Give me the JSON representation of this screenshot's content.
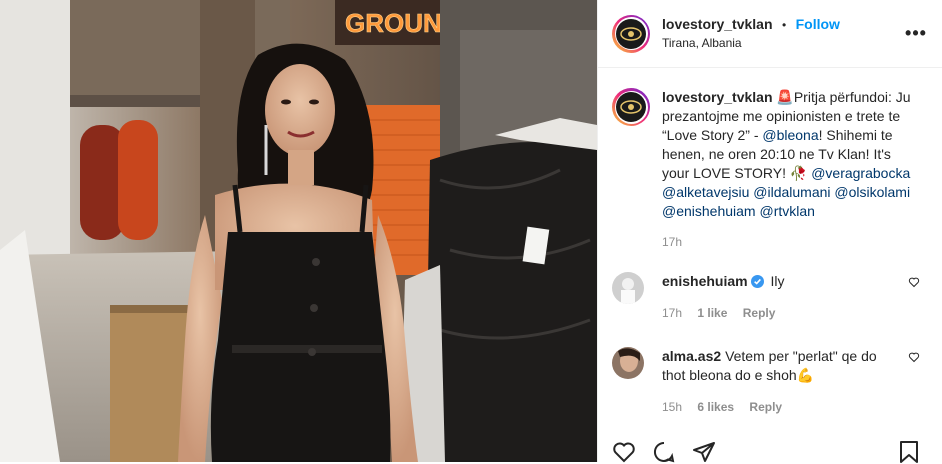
{
  "post": {
    "username": "lovestory_tvklan",
    "follow_label": "Follow",
    "location": "Tirana, Albania",
    "more_label": "•••",
    "photo_sign_text": "GROUND"
  },
  "caption": {
    "username": "lovestory_tvklan",
    "emoji_siren": "🚨",
    "text_1": "Pritja përfundoi: Ju prezantojme me opinionisten e trete te “Love Story 2” - ",
    "mention_1": "@bleona",
    "text_2": "! Shihemi te henen, ne oren 20:10 ne Tv Klan! It's your LOVE STORY! ",
    "emoji_rose": "🥀",
    "mentions": [
      "@veragrabocka",
      "@alketavejsiu",
      "@ildalumani",
      "@olsikolami",
      "@enishehuiam",
      "@rtvklan"
    ],
    "time": "17h"
  },
  "comments": [
    {
      "username": "enishehuiam",
      "verified": true,
      "text": "Ily",
      "time": "17h",
      "likes": "1 like",
      "reply": "Reply"
    },
    {
      "username": "alma.as2",
      "verified": false,
      "text": "Vetem per \"perlat\" qe do thot bleona do e shoh",
      "emoji": "💪",
      "time": "15h",
      "likes": "6 likes",
      "reply": "Reply"
    }
  ],
  "icons": [
    "heart-icon",
    "comment-icon",
    "share-icon",
    "save-icon",
    "more-icon",
    "verified-icon",
    "like-comment-icon"
  ],
  "colors": {
    "link": "#0095f6",
    "mention": "#00376b",
    "muted": "#8e8e8e",
    "text": "#262626"
  }
}
